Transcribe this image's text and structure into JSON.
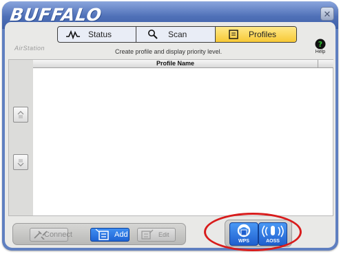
{
  "window": {
    "brand": "BUFFALO",
    "close_label": "✕"
  },
  "tabs": [
    {
      "label": "Status",
      "icon": "pulse-icon"
    },
    {
      "label": "Scan",
      "icon": "magnifier-icon"
    },
    {
      "label": "Profiles",
      "icon": "list-icon",
      "active": true
    }
  ],
  "header": {
    "airstation": "AirStation",
    "hint": "Create profile and display priority level.",
    "help_label": "Help"
  },
  "list": {
    "column": "Profile Name",
    "rows": []
  },
  "toolbar": {
    "connect": "Connect",
    "add": "Add",
    "edit": "Edit"
  },
  "wireless": {
    "wps": "WPS",
    "aoss": "AOSS"
  },
  "colors": {
    "frame": "#5f7fc0",
    "active_tab": "#f7c936",
    "button_blue": "#1f64d4",
    "highlight_ring": "#d81c1c"
  }
}
